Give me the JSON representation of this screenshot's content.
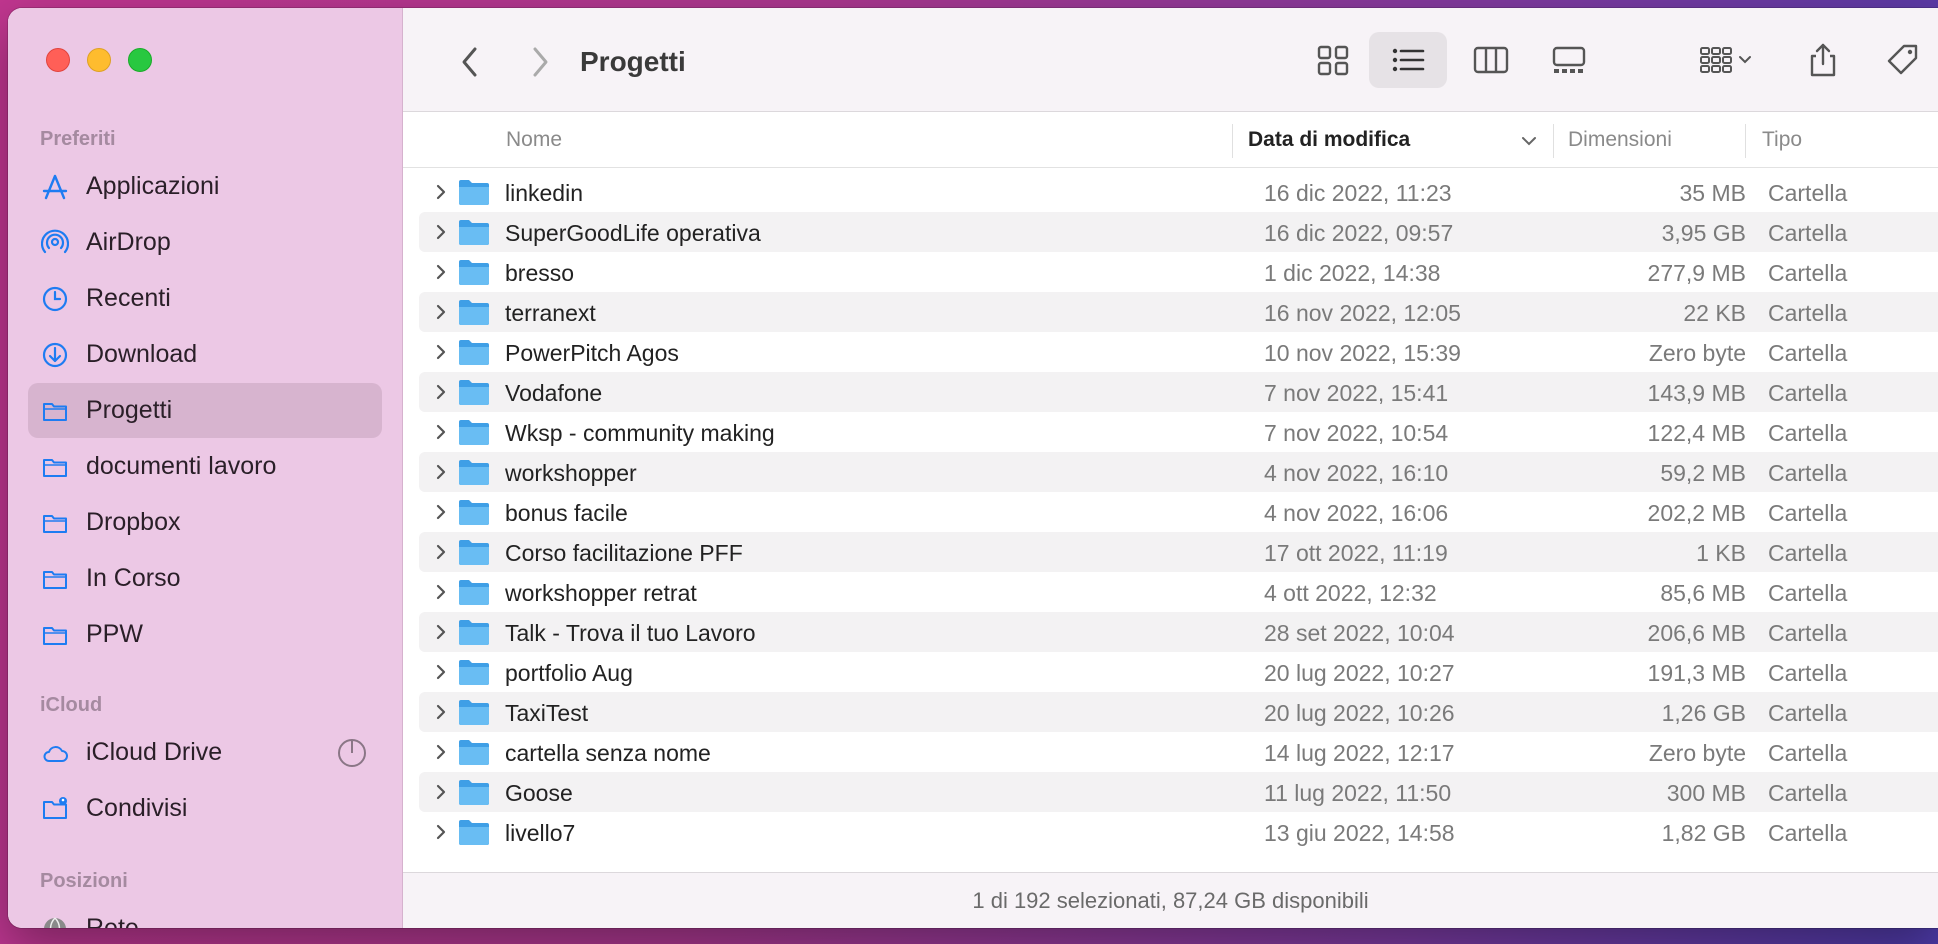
{
  "window": {
    "title": "Progetti"
  },
  "sidebar": {
    "sections": {
      "favorites": "Preferiti",
      "icloud": "iCloud",
      "locations": "Posizioni"
    },
    "favorites": [
      {
        "label": "Applicazioni",
        "icon": "applications-icon"
      },
      {
        "label": "AirDrop",
        "icon": "airdrop-icon"
      },
      {
        "label": "Recenti",
        "icon": "clock-icon"
      },
      {
        "label": "Download",
        "icon": "download-icon"
      },
      {
        "label": "Progetti",
        "icon": "folder-icon",
        "selected": true
      },
      {
        "label": "documenti lavoro",
        "icon": "folder-icon"
      },
      {
        "label": "Dropbox",
        "icon": "folder-icon"
      },
      {
        "label": "In Corso",
        "icon": "folder-icon"
      },
      {
        "label": "PPW",
        "icon": "folder-icon"
      }
    ],
    "icloud_items": [
      {
        "label": "iCloud Drive",
        "icon": "cloud-icon"
      },
      {
        "label": "Condivisi",
        "icon": "shared-folder-icon"
      }
    ],
    "locations_items": [
      {
        "label": "Rete",
        "icon": "network-icon"
      }
    ]
  },
  "columns": {
    "name": "Nome",
    "date": "Data di modifica",
    "size": "Dimensioni",
    "kind": "Tipo"
  },
  "files": [
    {
      "name": "linkedin",
      "date": "16 dic 2022, 11:23",
      "size": "35 MB",
      "kind": "Cartella"
    },
    {
      "name": "SuperGoodLife operativa",
      "date": "16 dic 2022, 09:57",
      "size": "3,95 GB",
      "kind": "Cartella"
    },
    {
      "name": "bresso",
      "date": "1 dic 2022, 14:38",
      "size": "277,9 MB",
      "kind": "Cartella"
    },
    {
      "name": "terranext",
      "date": "16 nov 2022, 12:05",
      "size": "22 KB",
      "kind": "Cartella"
    },
    {
      "name": "PowerPitch Agos",
      "date": "10 nov 2022, 15:39",
      "size": "Zero byte",
      "kind": "Cartella"
    },
    {
      "name": "Vodafone",
      "date": "7 nov 2022, 15:41",
      "size": "143,9 MB",
      "kind": "Cartella"
    },
    {
      "name": "Wksp - community making",
      "date": "7 nov 2022, 10:54",
      "size": "122,4 MB",
      "kind": "Cartella"
    },
    {
      "name": "workshopper",
      "date": "4 nov 2022, 16:10",
      "size": "59,2 MB",
      "kind": "Cartella"
    },
    {
      "name": "bonus facile",
      "date": "4 nov 2022, 16:06",
      "size": "202,2 MB",
      "kind": "Cartella"
    },
    {
      "name": "Corso facilitazione PFF",
      "date": "17 ott 2022, 11:19",
      "size": "1 KB",
      "kind": "Cartella"
    },
    {
      "name": "workshopper retrat",
      "date": "4 ott 2022, 12:32",
      "size": "85,6 MB",
      "kind": "Cartella"
    },
    {
      "name": "Talk - Trova il tuo Lavoro",
      "date": "28 set 2022, 10:04",
      "size": "206,6 MB",
      "kind": "Cartella"
    },
    {
      "name": "portfolio Aug",
      "date": "20 lug 2022, 10:27",
      "size": "191,3 MB",
      "kind": "Cartella"
    },
    {
      "name": "TaxiTest",
      "date": "20 lug 2022, 10:26",
      "size": "1,26 GB",
      "kind": "Cartella"
    },
    {
      "name": "cartella senza nome",
      "date": "14 lug 2022, 12:17",
      "size": "Zero byte",
      "kind": "Cartella"
    },
    {
      "name": "Goose",
      "date": "11 lug 2022, 11:50",
      "size": "300 MB",
      "kind": "Cartella"
    },
    {
      "name": "livello7",
      "date": "13 giu 2022, 14:58",
      "size": "1,82 GB",
      "kind": "Cartella"
    }
  ],
  "status": "1 di 192 selezionati, 87,24 GB disponibili",
  "colors": {
    "sidebar_bg": "#ecc8e5",
    "selected_bg": "#d7b4cf",
    "accent_blue": "#1e7cf2",
    "folder_blue": "#5ab4f0"
  }
}
